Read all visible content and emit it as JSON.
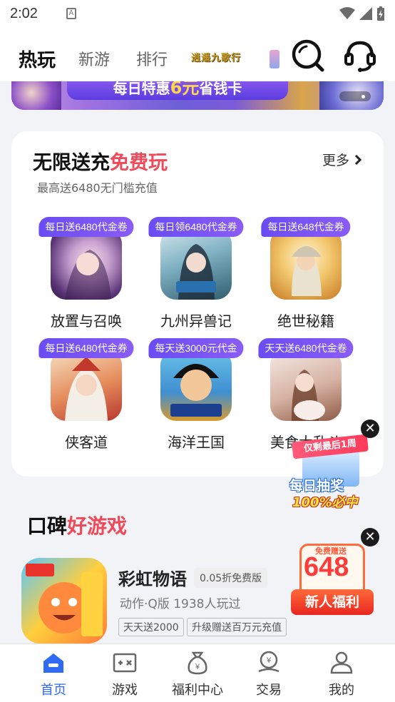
{
  "status_bar": {
    "time": "2:02",
    "notification_icon": "a-notification-icon",
    "wifi_icon": "wifi-icon",
    "signal_icon": "signal-icon",
    "battery_icon": "battery-charging-icon"
  },
  "top_nav": {
    "tabs": [
      {
        "label": "热玩",
        "active": true
      },
      {
        "label": "新游",
        "active": false
      },
      {
        "label": "排行",
        "active": false
      }
    ],
    "brand_logo": "逍遥九歌行",
    "search_icon": "search-icon",
    "service_icon": "headset-icon"
  },
  "banner": {
    "title_prefix": "每日特惠",
    "title_highlight": "6元",
    "title_suffix": "省钱卡"
  },
  "free_recharge": {
    "title": "无限送充",
    "title_highlight": "免费玩",
    "subtitle": "最高送6480无门槛充值",
    "more": "更多",
    "games": [
      {
        "badge": "每日送6480代金卷",
        "name": "放置与召唤"
      },
      {
        "badge": "每日领6480代金券",
        "name": "九州异兽记"
      },
      {
        "badge": "每日送648代金券",
        "name": "绝世秘籍"
      },
      {
        "badge": "每日送6480代金券",
        "name": "侠客道"
      },
      {
        "badge": "每天送3000元代金",
        "name": "海洋王国"
      },
      {
        "badge": "天天送6480代金卷",
        "name": "美食大乱斗"
      }
    ]
  },
  "good_games": {
    "title": "口碑",
    "title_highlight": "好游戏",
    "item": {
      "name": "彩虹物语",
      "tag": "0.05折免费版",
      "meta": "动作·Q版  1938人玩过",
      "chips": [
        "天天送2000",
        "升级赠送百万元充值"
      ]
    }
  },
  "floats": {
    "lottery": {
      "top_text": "仅剩最后1周",
      "line1": "每日抽奖",
      "line2": "100%必中"
    },
    "newbie": {
      "free_text": "免费赠送",
      "amount": "648",
      "ribbon": "新人福利"
    },
    "close_symbol": "✕"
  },
  "tab_bar": [
    {
      "label": "首页",
      "icon": "home-icon",
      "active": true
    },
    {
      "label": "游戏",
      "icon": "gamepad-icon",
      "active": false
    },
    {
      "label": "福利中心",
      "icon": "money-bag-icon",
      "active": false
    },
    {
      "label": "交易",
      "icon": "trade-icon",
      "active": false
    },
    {
      "label": "我的",
      "icon": "profile-icon",
      "active": false
    }
  ],
  "colors": {
    "accent_blue": "#2f6bf5",
    "highlight_red": "#f04a5a",
    "badge_purple": "#6a4df3"
  }
}
